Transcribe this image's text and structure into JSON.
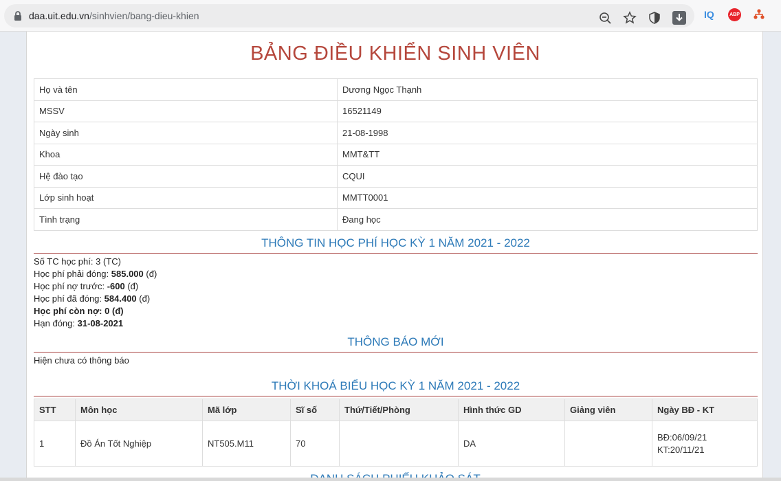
{
  "browser": {
    "url_host": "daa.uit.edu.vn",
    "url_path": "/sinhvien/bang-dieu-khien",
    "ext_iq": "IQ",
    "ext_abp": "ABP"
  },
  "page": {
    "title": "BẢNG ĐIỀU KHIỂN SINH VIÊN",
    "profile": [
      {
        "label": "Họ và tên",
        "value": "Dương Ngọc Thạnh"
      },
      {
        "label": "MSSV",
        "value": "16521149"
      },
      {
        "label": "Ngày sinh",
        "value": "21-08-1998"
      },
      {
        "label": "Khoa",
        "value": "MMT&TT"
      },
      {
        "label": "Hệ đào tạo",
        "value": "CQUI"
      },
      {
        "label": "Lớp sinh hoạt",
        "value": "MMTT0001"
      },
      {
        "label": "Tình trạng",
        "value": "Đang học"
      }
    ],
    "fee_heading": "THÔNG TIN HỌC PHÍ HỌC KỲ 1 NĂM 2021 - 2022",
    "fee": {
      "so_tc_label": "Số TC học phí:",
      "so_tc_value": "3 (TC)",
      "phai_dong_label": "Học phí phải đóng:",
      "phai_dong_value": "585.000",
      "no_truoc_label": "Học phí nợ trước:",
      "no_truoc_value": "-600",
      "da_dong_label": "Học phí đã đóng:",
      "da_dong_value": "584.400",
      "con_no_label": "Học phí còn nợ:",
      "con_no_value": "0",
      "han_dong_label": "Hạn đóng:",
      "han_dong_value": "31-08-2021",
      "unit": "(đ)"
    },
    "notice_heading": "THÔNG BÁO MỚI",
    "notice_text": "Hiện chưa có thông báo",
    "schedule_heading": "THỜI KHOÁ BIỂU HỌC KỲ 1 NĂM 2021 - 2022",
    "schedule_columns": [
      "STT",
      "Môn học",
      "Mã lớp",
      "Sĩ số",
      "Thứ/Tiết/Phòng",
      "Hình thức GD",
      "Giảng viên",
      "Ngày BĐ - KT"
    ],
    "schedule_rows": [
      {
        "stt": "1",
        "mon_hoc": "Đồ Án Tốt Nghiệp",
        "ma_lop": "NT505.M11",
        "si_so": "70",
        "thu_tiet_phong": "",
        "hinh_thuc": "DA",
        "giang_vien": "",
        "ngay_bd": "BĐ:06/09/21",
        "ngay_kt": "KT:20/11/21"
      }
    ],
    "next_heading": "DANH SÁCH PHIẾU KHẢO SÁT"
  }
}
